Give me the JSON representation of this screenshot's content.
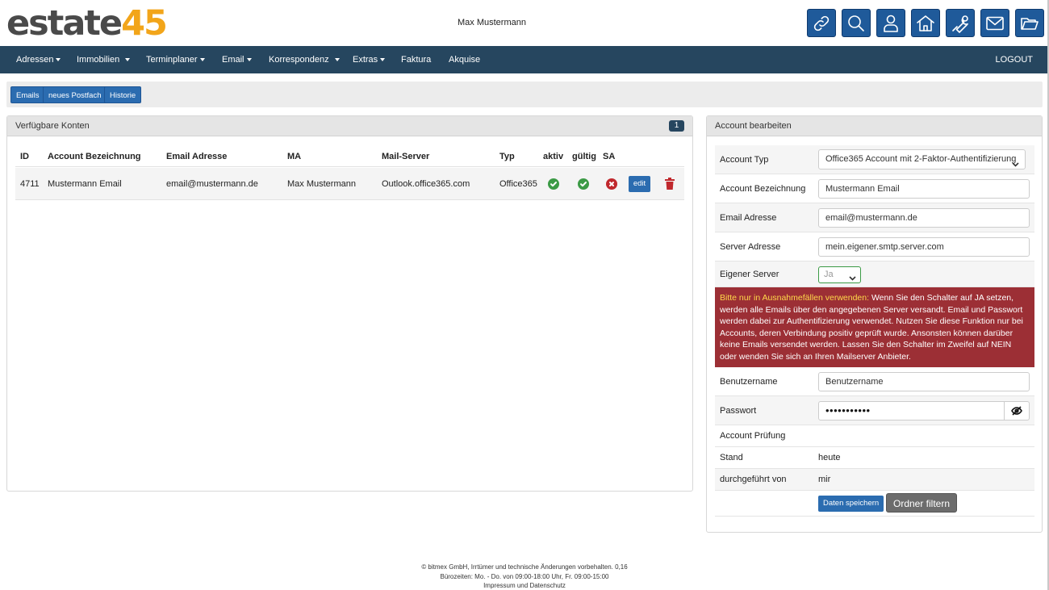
{
  "app": {
    "logo_part1": "estate",
    "logo_part2": "45",
    "user": "Max Mustermann"
  },
  "header_icons": [
    "link-icon",
    "search-icon",
    "user-icon",
    "home-icon",
    "wrench-icon",
    "mail-icon",
    "folder-icon"
  ],
  "nav": {
    "items": [
      "Adressen",
      "Immobilien",
      "Terminplaner",
      "Email",
      "Korrespondenz",
      "Extras",
      "Faktura",
      "Akquise"
    ],
    "logout": "LOGOUT"
  },
  "subnav": {
    "emails": "Emails",
    "new_mailbox": "neues Postfach",
    "history": "Historie"
  },
  "accounts": {
    "title": "Verfügbare Konten",
    "count": "1",
    "columns": [
      "ID",
      "Account Bezeichnung",
      "Email Adresse",
      "MA",
      "Mail-Server",
      "Typ",
      "aktiv",
      "gültig",
      "SA"
    ],
    "rows": [
      {
        "id": "4711",
        "name": "Mustermann Email",
        "email": "email@mustermann.de",
        "ma": "Max Mustermann",
        "server": "Outlook.office365.com",
        "typ": "Office365",
        "aktiv": true,
        "gueltig": true,
        "sa": false,
        "edit_label": "edit"
      }
    ]
  },
  "edit": {
    "title": "Account bearbeiten",
    "account_typ_label": "Account Typ",
    "account_typ_value": "Office365 Account mit 2-Faktor-Authentifizierung",
    "bezeichnung_label": "Account Bezeichnung",
    "bezeichnung_value": "Mustermann Email",
    "email_label": "Email Adresse",
    "email_value": "email@mustermann.de",
    "server_label": "Server Adresse",
    "server_value": "mein.eigener.smtp.server.com",
    "eigener_label": "Eigener Server",
    "eigener_value": "Ja",
    "warning_highlight": "Bitte nur in Ausnahmefällen verwenden:",
    "warning_text": " Wenn Sie den Schalter auf JA setzen, werden alle Emails über den angegebenen Server versandt. Email und Passwort werden dabei zur Authentifizierung verwendet. Nutzen Sie diese Funktion nur bei Accounts, deren Verbindung positiv geprüft wurde. Ansonsten können darüber keine Emails versendet werden. Lassen Sie den Schalter im Zweifel auf NEIN oder wenden Sie sich an Ihren Mailserver Anbieter.",
    "benutzer_label": "Benutzername",
    "benutzer_value": "Benutzername",
    "passwort_label": "Passwort",
    "passwort_value": "•••••••••••",
    "pruefung_label": "Account Prüfung",
    "stand_label": "Stand",
    "stand_value": "heute",
    "durch_label": "durchgeführt von",
    "durch_value": "mir",
    "save_label": "Daten speichern",
    "filter_label": "Ordner filtern"
  },
  "footer": {
    "line1": "© bitmex GmbH, Irrtümer und technische Änderungen vorbehalten. 0,16",
    "line2": "Bürozeiten: Mo. - Do. von 09:00-18:00 Uhr, Fr. 09:00-15:00",
    "impressum": "Impressum",
    "und": "und",
    "datenschutz": "Datenschutz"
  },
  "colors": {
    "primary": "#2b6cb0",
    "nav": "#26465f",
    "warning": "#9c2f35",
    "logo_accent": "#f2a51a",
    "ok": "#3b9a45",
    "bad": "#c0282d"
  }
}
